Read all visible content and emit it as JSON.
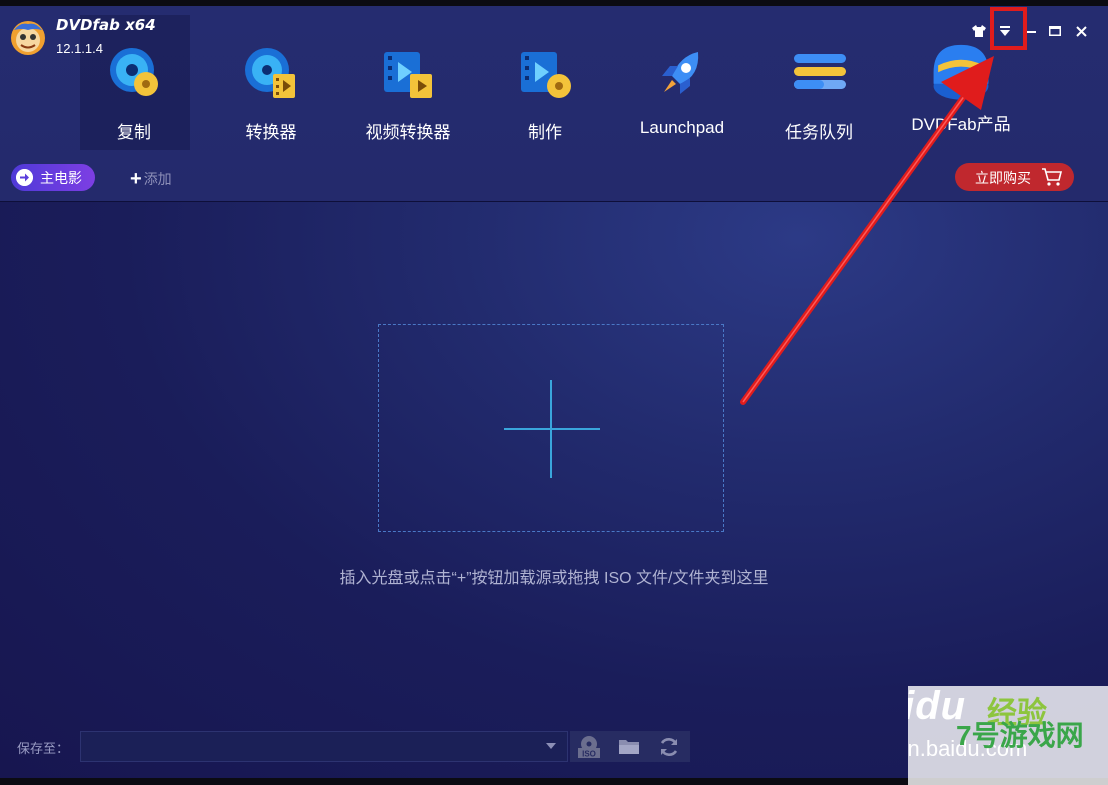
{
  "app": {
    "brand": "DVDfab x64",
    "version": "12.1.1.4"
  },
  "nav": [
    {
      "label": "复制",
      "icon": "copy-disc-icon"
    },
    {
      "label": "转换器",
      "icon": "converter-disc-icon"
    },
    {
      "label": "视频转换器",
      "icon": "video-converter-icon"
    },
    {
      "label": "制作",
      "icon": "creator-icon"
    },
    {
      "label": "Launchpad",
      "icon": "rocket-icon"
    },
    {
      "label": "任务队列",
      "icon": "task-queue-icon"
    },
    {
      "label": "DVDFab产品",
      "icon": "dvdfab-products-icon"
    }
  ],
  "window_controls": [
    "skin-icon",
    "menu-dropdown-icon",
    "minimize-icon",
    "maximize-icon",
    "close-icon"
  ],
  "toolbar": {
    "main_movie": "主电影",
    "add": "添加",
    "buy": "立即购买"
  },
  "drop": {
    "hint": "插入光盘或点击“+”按钮加载源或拖拽 ISO 文件/文件夹到这里"
  },
  "footer": {
    "save_to": "保存至：",
    "save_path": "",
    "iso_icon": "ISO"
  },
  "watermark": {
    "baidu": "Baidu",
    "jingyan": "经验",
    "site": "jingyan.baidu.com",
    "logo": "7号游戏网"
  },
  "colors": {
    "accent_purple": "#6a3ce0",
    "buy_red": "#c0282e",
    "drop_blue": "#3aa6dc",
    "annotation_red": "#e01c1c"
  }
}
